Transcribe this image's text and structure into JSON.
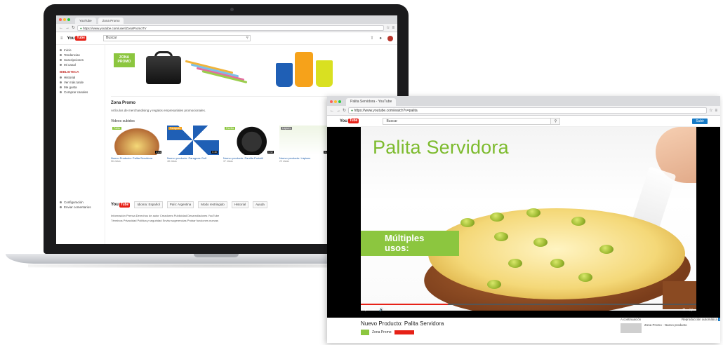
{
  "laptop": {
    "tabs": [
      "YouTube",
      "Zona Promo"
    ],
    "url": "https://www.youtube.com/user/ZonaPromoTV",
    "search_value": "Buscar",
    "sidebar": {
      "items": [
        "Inicio",
        "Tendencias",
        "Suscripciones",
        "Mi canal"
      ],
      "section": "BIBLIOTECA",
      "library": [
        "Historial",
        "Ver más tarde",
        "Me gusta",
        "Comprar canales"
      ],
      "bottom": [
        "Configuración",
        "Enviar comentarios"
      ]
    },
    "banner_logo": "ZONA PROMO",
    "channel_title": "Zona Promo",
    "channel_desc": "Artículos de merchandising y regalos empresariales promocionales.",
    "videos_title": "Videos subidos",
    "videos": [
      {
        "label": "Palita",
        "title": "Nuevo Producto: Palita Servidora",
        "meta": "56 vistas",
        "duration": "1:24"
      },
      {
        "label": "Paraguas",
        "title": "Nuevo producto: Paraguas Golf",
        "meta": "48 vistas",
        "duration": "0:40"
      },
      {
        "label": "Parrilla",
        "title": "Nuevo producto: Parrilla Portátil",
        "meta": "37 vistas",
        "duration": "0:52"
      },
      {
        "label": "Lápices",
        "title": "Nuevo producto: Lápices",
        "meta": "29 vistas",
        "duration": "0:36"
      }
    ],
    "bottom_bar": [
      "Idioma: Español",
      "País: Argentina",
      "Modo restringido",
      "Historial",
      "Ayuda"
    ],
    "footer_links": "Información  Prensa  Derechos de autor  Creadores  Publicidad  Desarrolladores  YouTube",
    "footer_links2": "Términos  Privacidad  Política y seguridad  Enviar sugerencias  Probar funciones nuevas"
  },
  "window2": {
    "tab": "Palita Servidora - YouTube",
    "url": "https://www.youtube.com/watch?v=palita",
    "search_value": "Buscar",
    "upload_label": "Subir",
    "video_title_overlay": "Palita Servidora",
    "overlay_label_line1": "Múltiples",
    "overlay_label_line2": "usos:",
    "time_display": "0:14 / 1:24",
    "progress_fraction": 0.26,
    "video_title": "Nuevo Producto: Palita Servidora",
    "channel_name": "Zona Promo",
    "up_next": "A continuación",
    "autoplay": "Reproducción automática",
    "autoplay_state": "ON",
    "next_video": "Zona Promo - Nuevo producto"
  },
  "colors": {
    "yt_red": "#e62117",
    "brand_green": "#8cc63f",
    "link_blue": "#1a5aa8",
    "upload_blue": "#167ac6"
  }
}
